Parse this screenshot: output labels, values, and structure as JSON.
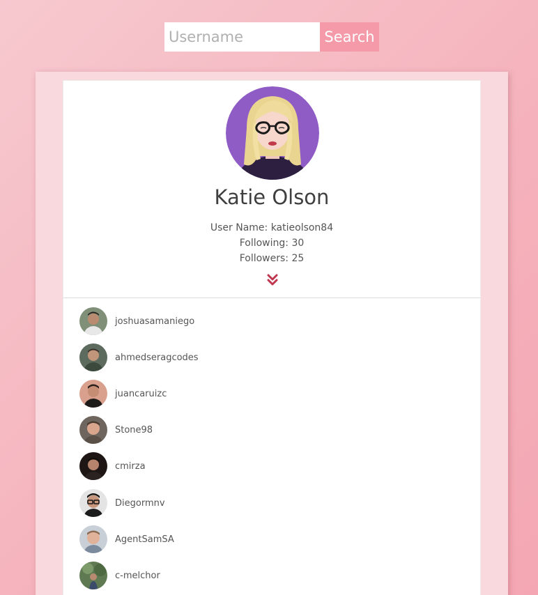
{
  "search": {
    "placeholder": "Username",
    "value": "",
    "button_label": "Search"
  },
  "profile": {
    "name": "Katie Olson",
    "username_line": "User Name: katieolson84",
    "following_line": "Following: 30",
    "followers_line": "Followers: 25",
    "avatar_icon": "avatar-illustration-woman-blonde-glasses",
    "expand_icon": "double-chevron-down-icon"
  },
  "followers": [
    {
      "username": "joshuasamaniego"
    },
    {
      "username": "ahmedseragcodes"
    },
    {
      "username": "juancaruizc"
    },
    {
      "username": "Stone98"
    },
    {
      "username": "cmirza"
    },
    {
      "username": "Diegormnv"
    },
    {
      "username": "AgentSamSA"
    },
    {
      "username": "c-melchor"
    }
  ],
  "colors": {
    "page_background": "#f5b3bd",
    "search_button": "#f49aa8",
    "outer_card": "#f9d9dd",
    "accent_icon": "#c0364f",
    "text": "#555555"
  }
}
